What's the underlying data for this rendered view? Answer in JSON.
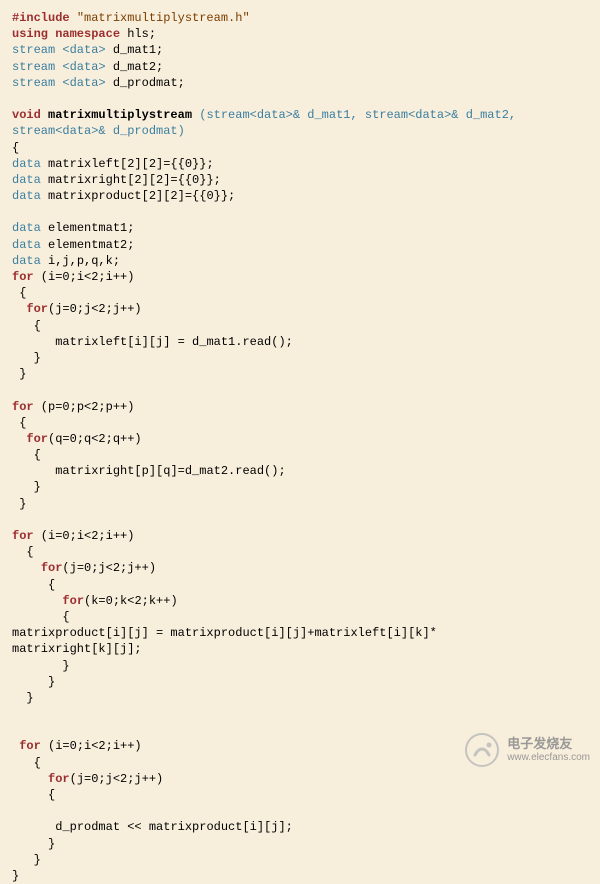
{
  "code": {
    "l1_kw": "#include",
    "l1_str": "\"matrixmultiplystream.h\"",
    "l2_kw": "using namespace",
    "l2_id": "hls;",
    "l3_type": "stream <data>",
    "l3_id": "d_mat1;",
    "l4_type": "stream <data>",
    "l4_id": "d_mat2;",
    "l5_type": "stream <data>",
    "l5_id": "d_prodmat;",
    "fn_kw": "void",
    "fn_name": "matrixmultiplystream",
    "fn_sig1": " (stream<data>& d_mat1, stream<data>& d_mat2,",
    "fn_sig2": "stream<data>& d_prodmat)",
    "ob": "{",
    "cb": "}",
    "d1": "data",
    "decl_ml": "matrixleft[2][2]={{0}};",
    "decl_mr": "matrixright[2][2]={{0}};",
    "decl_mp": "matrixproduct[2][2]={{0}};",
    "decl_em1": "elementmat1;",
    "decl_em2": "elementmat2;",
    "decl_idx": "i,j,p,q,k;",
    "for_kw": "for",
    "for_i": " (i=0;i<2;i++)",
    "for_j": "(j=0;j<2;j++)",
    "for_p": " (p=0;p<2;p++)",
    "for_q": "(q=0;q<2;q++)",
    "for_k": "(k=0;k<2;k++)",
    "read1": "matrixleft[i][j] = d_mat1.read();",
    "read2": "matrixright[p][q]=d_mat2.read();",
    "mult1": "matrixproduct[i][j] = matrixproduct[i][j]+matrixleft[i][k]*",
    "mult2": "matrixright[k][j];",
    "out": "d_prodmat << matrixproduct[i][j];"
  },
  "watermark": {
    "site_name": "电子发烧友",
    "url": "www.elecfans.com"
  }
}
